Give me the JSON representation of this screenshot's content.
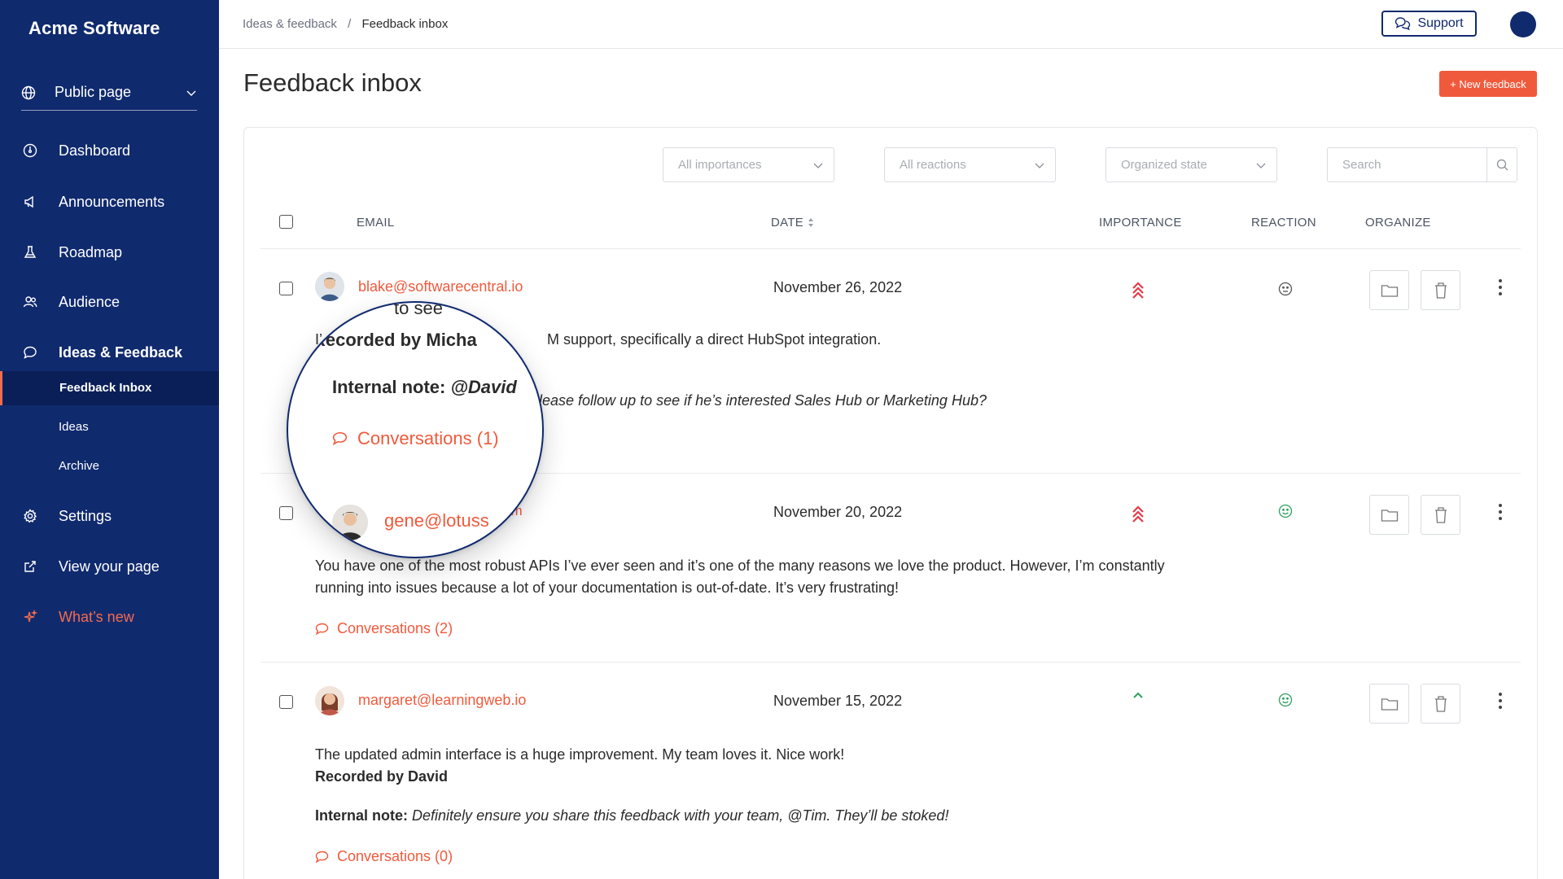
{
  "brand": "Acme Software",
  "sidebar": {
    "public_page": "Public page",
    "items": [
      {
        "label": "Dashboard",
        "icon": "dashboard-icon"
      },
      {
        "label": "Announcements",
        "icon": "megaphone-icon"
      },
      {
        "label": "Roadmap",
        "icon": "flask-icon"
      },
      {
        "label": "Audience",
        "icon": "users-icon"
      },
      {
        "label": "Ideas & Feedback",
        "icon": "chat-icon"
      }
    ],
    "sub_items": [
      "Feedback Inbox",
      "Ideas",
      "Archive"
    ],
    "settings": "Settings",
    "view_page": "View your page",
    "whats_new": "What’s new"
  },
  "topbar": {
    "breadcrumb_parent": "Ideas & feedback",
    "breadcrumb_sep": "/",
    "breadcrumb_current": "Feedback inbox",
    "support": "Support"
  },
  "page": {
    "title": "Feedback inbox",
    "new_feedback": "+ New feedback"
  },
  "filters": {
    "importance": "All importances",
    "reactions": "All reactions",
    "state": "Organized state",
    "search_placeholder": "Search"
  },
  "columns": {
    "email": "EMAIL",
    "date": "DATE",
    "importance": "IMPORTANCE",
    "reaction": "REACTION",
    "organize": "ORGANIZE"
  },
  "rows": [
    {
      "email": "blake@softwarecentral.io",
      "date": "November 26, 2022",
      "line1_start": "I’",
      "line1_end": "M support, specifically a direct HubSpot integration.",
      "line3_end": "lease follow up to see if he’s interested Sales Hub or Marketing Hub?",
      "importance": "high",
      "reaction": "neutral"
    },
    {
      "email_tail": "om",
      "date": "November 20, 2022",
      "text_line1": "You have one of the most robust APIs I’ve ever seen and it’s one of the many reasons we love the product. However, I’m constantly",
      "text_line2": "running into issues because a lot of your documentation is out-of-date. It’s very frustrating!",
      "conversations": "Conversations (2)",
      "importance": "high",
      "reaction": "happy"
    },
    {
      "email": "margaret@learningweb.io",
      "date": "November 15, 2022",
      "text": "The updated admin interface is a huge improvement. My team loves it. Nice work!",
      "recorded": "Recorded by David",
      "note_label": "Internal note:",
      "note_text": "Definitely ensure you share this feedback with your team, @Tim. They’ll be stoked!",
      "conversations": "Conversations (0)",
      "importance": "low",
      "reaction": "happy"
    }
  ],
  "magnifier": {
    "top_fragment": "to see",
    "recorded": "Recorded by Micha",
    "note_label": "Internal note:",
    "note_mention": "@David",
    "conversations": "Conversations (1)",
    "email": "gene@lotuss"
  },
  "colors": {
    "navy": "#102a6e",
    "accent": "#f05a3c",
    "green": "#2ea05f"
  }
}
